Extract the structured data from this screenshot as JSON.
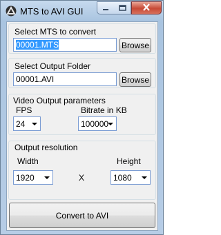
{
  "window": {
    "title": "MTS to AVI GUI",
    "icon": "triangle-app-icon"
  },
  "caption_buttons": {
    "minimize_icon": "minimize-icon",
    "maximize_icon": "maximize-icon",
    "close_icon": "close-icon"
  },
  "input_group": {
    "label": "Select MTS to convert",
    "value": "00001.MTS",
    "browse_label": "Browse"
  },
  "output_group": {
    "label": "Select Output Folder",
    "value": "00001.AVI",
    "browse_label": "Browse"
  },
  "video_params": {
    "label": "Video Output parameters",
    "fps_label": "FPS",
    "fps_value": "24",
    "bitrate_label": "Bitrate in KB",
    "bitrate_value": "100000l"
  },
  "resolution": {
    "label": "Output resolution",
    "width_label": "Width",
    "width_value": "1920",
    "separator": "X",
    "height_label": "Height",
    "height_value": "1080"
  },
  "convert_button": {
    "label": "Convert to AVI"
  }
}
